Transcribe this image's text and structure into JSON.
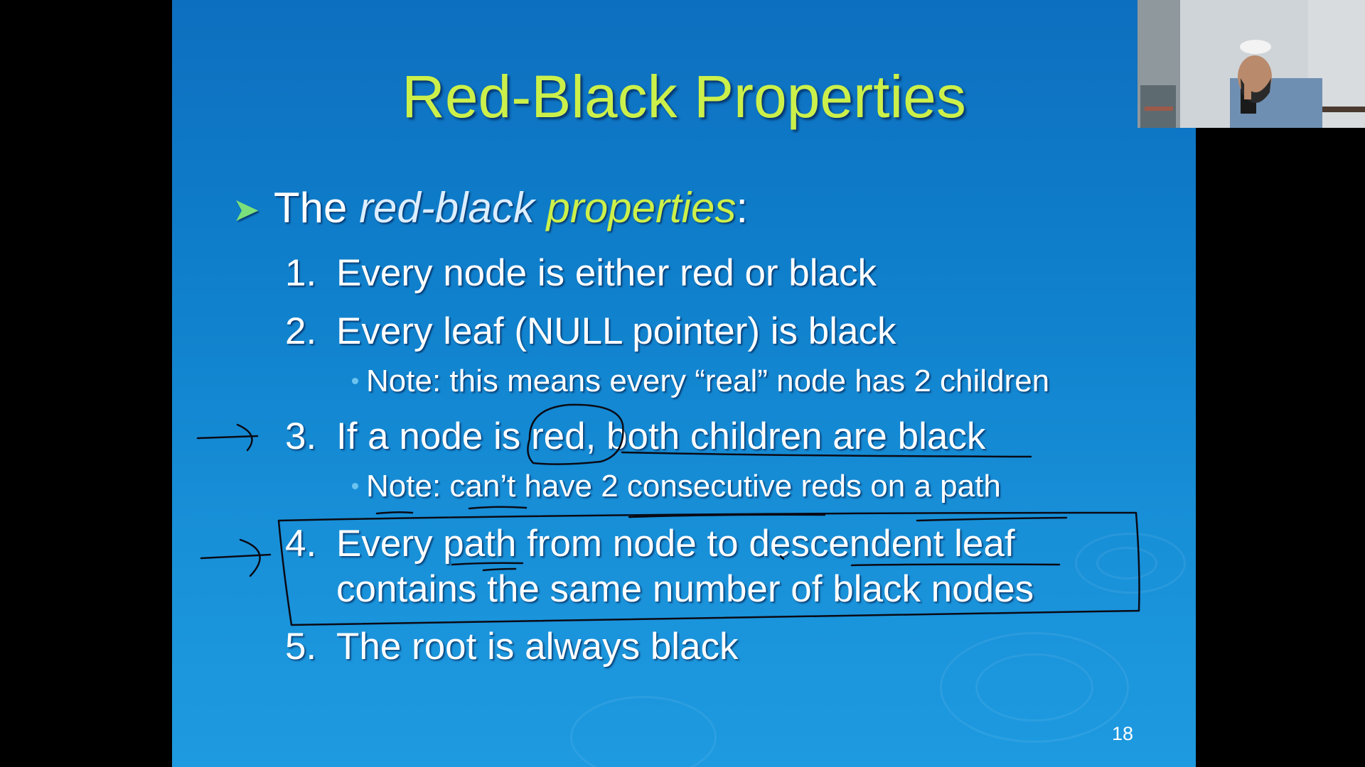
{
  "slide": {
    "title": "Red-Black Properties",
    "intro": {
      "prefix": "The ",
      "em1": "red-black",
      "em2": "properties",
      "suffix": ":"
    },
    "items": [
      {
        "num": "1.",
        "text": "Every node is either red or black"
      },
      {
        "num": "2.",
        "text": "Every leaf (NULL pointer) is black"
      },
      {
        "note": "Note: this means every “real” node has 2 children"
      },
      {
        "num": "3.",
        "text": "If a node is red, both children are black"
      },
      {
        "note": "Note: can’t have 2 consecutive reds on a path"
      },
      {
        "num": "4.",
        "text": "Every path from node to descendent leaf",
        "text2": "contains the same number of black nodes"
      },
      {
        "num": "5.",
        "text": "The root is always black"
      }
    ],
    "page_number": "18"
  },
  "colors": {
    "title": "#ccf04a",
    "background_top": "#0d6fbf",
    "background_bottom": "#1e9ae0",
    "ink": "#0a0a14"
  },
  "webcam": {
    "icon": "presenter-video-icon"
  }
}
